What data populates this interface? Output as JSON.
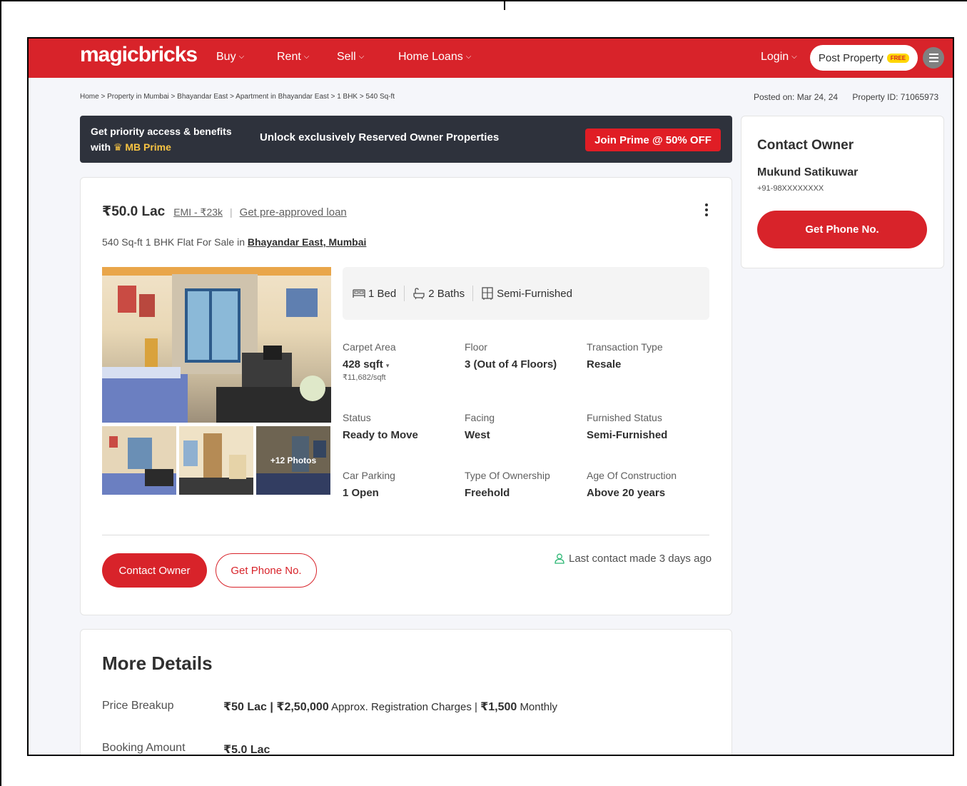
{
  "header": {
    "logo": "magicbricks",
    "nav": [
      "Buy",
      "Rent",
      "Sell",
      "Home Loans"
    ],
    "login": "Login",
    "post_property": "Post Property",
    "free_badge": "FREE",
    "brand_color": "#d8232a"
  },
  "breadcrumb": "Home > Property in Mumbai > Bhayandar East > Apartment in Bhayandar East > 1 BHK > 540 Sq-ft",
  "posted_on": "Posted on: Mar 24, 24",
  "property_id": "Property ID: 71065973",
  "prime_banner": {
    "line1": "Get priority access & benefits",
    "line2_prefix": "with",
    "line2_brand": "MB Prime",
    "message": "Unlock exclusively Reserved Owner Properties",
    "cta": "Join Prime @ 50% OFF"
  },
  "listing": {
    "price": "₹50.0 Lac",
    "emi": "EMI - ₹23k",
    "loan_link": "Get pre-approved loan",
    "title_prefix": "540 Sq-ft 1 BHK Flat For Sale in",
    "location": "Bhayandar East, Mumbai",
    "photos_overlay": "+12 Photos",
    "features": {
      "bed": "1 Bed",
      "baths": "2 Baths",
      "furnishing": "Semi-Furnished"
    },
    "details": [
      {
        "label": "Carpet Area",
        "value": "428 sqft",
        "sub": "₹11,682/sqft"
      },
      {
        "label": "Floor",
        "value": "3 (Out of 4 Floors)"
      },
      {
        "label": "Transaction Type",
        "value": "Resale"
      },
      {
        "label": "Status",
        "value": "Ready to Move"
      },
      {
        "label": "Facing",
        "value": "West"
      },
      {
        "label": "Furnished Status",
        "value": "Semi-Furnished"
      },
      {
        "label": "Car Parking",
        "value": "1 Open"
      },
      {
        "label": "Type Of Ownership",
        "value": "Freehold"
      },
      {
        "label": "Age Of Construction",
        "value": "Above 20 years"
      }
    ],
    "contact_owner_btn": "Contact Owner",
    "get_phone_btn": "Get Phone No.",
    "last_contact": "Last contact made 3 days ago"
  },
  "more_details": {
    "heading": "More Details",
    "price_breakup_label": "Price Breakup",
    "price_breakup_price": "₹50 Lac | ₹2,50,000",
    "price_breakup_reg": "Approx. Registration Charges |",
    "price_breakup_monthly_value": "₹1,500",
    "price_breakup_monthly": "Monthly",
    "booking_label": "Booking Amount",
    "booking_value": "₹5.0 Lac"
  },
  "sidebar": {
    "title": "Contact Owner",
    "name": "Mukund Satikuwar",
    "phone": "+91-98XXXXXXXX",
    "cta": "Get Phone No."
  }
}
